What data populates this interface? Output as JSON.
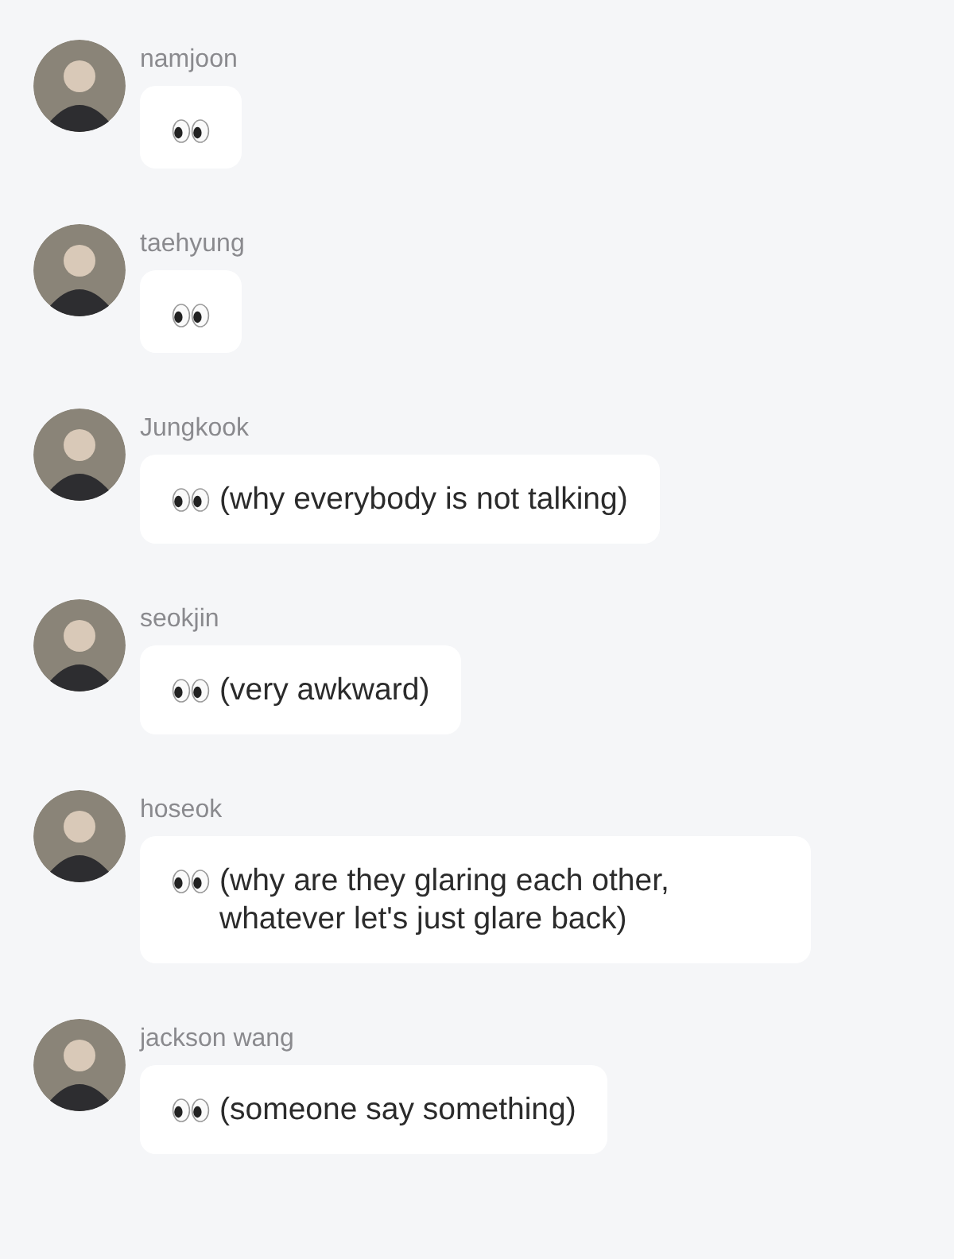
{
  "messages": [
    {
      "sender": "namjoon",
      "kind": "eyes"
    },
    {
      "sender": "taehyung",
      "kind": "eyes"
    },
    {
      "sender": "Jungkook",
      "kind": "eyes",
      "text": "(why everybody is not talking)"
    },
    {
      "sender": "seokjin",
      "kind": "eyes",
      "text": "(very awkward)"
    },
    {
      "sender": "hoseok",
      "kind": "eyes",
      "text": "(why are they glaring each other, whatever let's just glare back)"
    },
    {
      "sender": "jackson wang",
      "kind": "eyes",
      "text": "(someone say something)"
    }
  ]
}
